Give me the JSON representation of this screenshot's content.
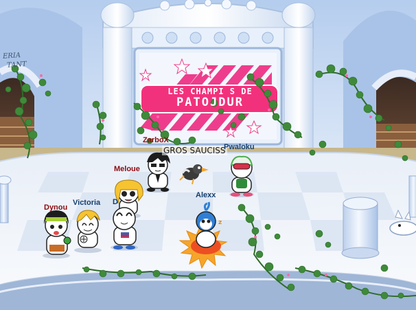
{
  "banner": {
    "line1": "LES CHAMPI  S DE",
    "line2": "PATOJDUR"
  },
  "sign": {
    "line1": "ERIA",
    "line2": "TANT"
  },
  "players": {
    "zarbox": "ZarboX",
    "pwaloku": "Pwaloku",
    "meloue": "Meloue",
    "alexx": "Alexx",
    "victoria": "Victoria",
    "dynou": "Dynou",
    "d_partial": "D"
  },
  "chat": {
    "gros_sauciss": "GROS SAUCISS"
  },
  "colors": {
    "sky_wall": "#bcd3ef",
    "floor_light": "#f3f6fb",
    "floor_tile": "#d9e4f2",
    "banner_pink": "#ee3d8c",
    "name_red": "#8b0b10",
    "name_blue": "#16406e",
    "ivy_green": "#3f8a3a"
  }
}
